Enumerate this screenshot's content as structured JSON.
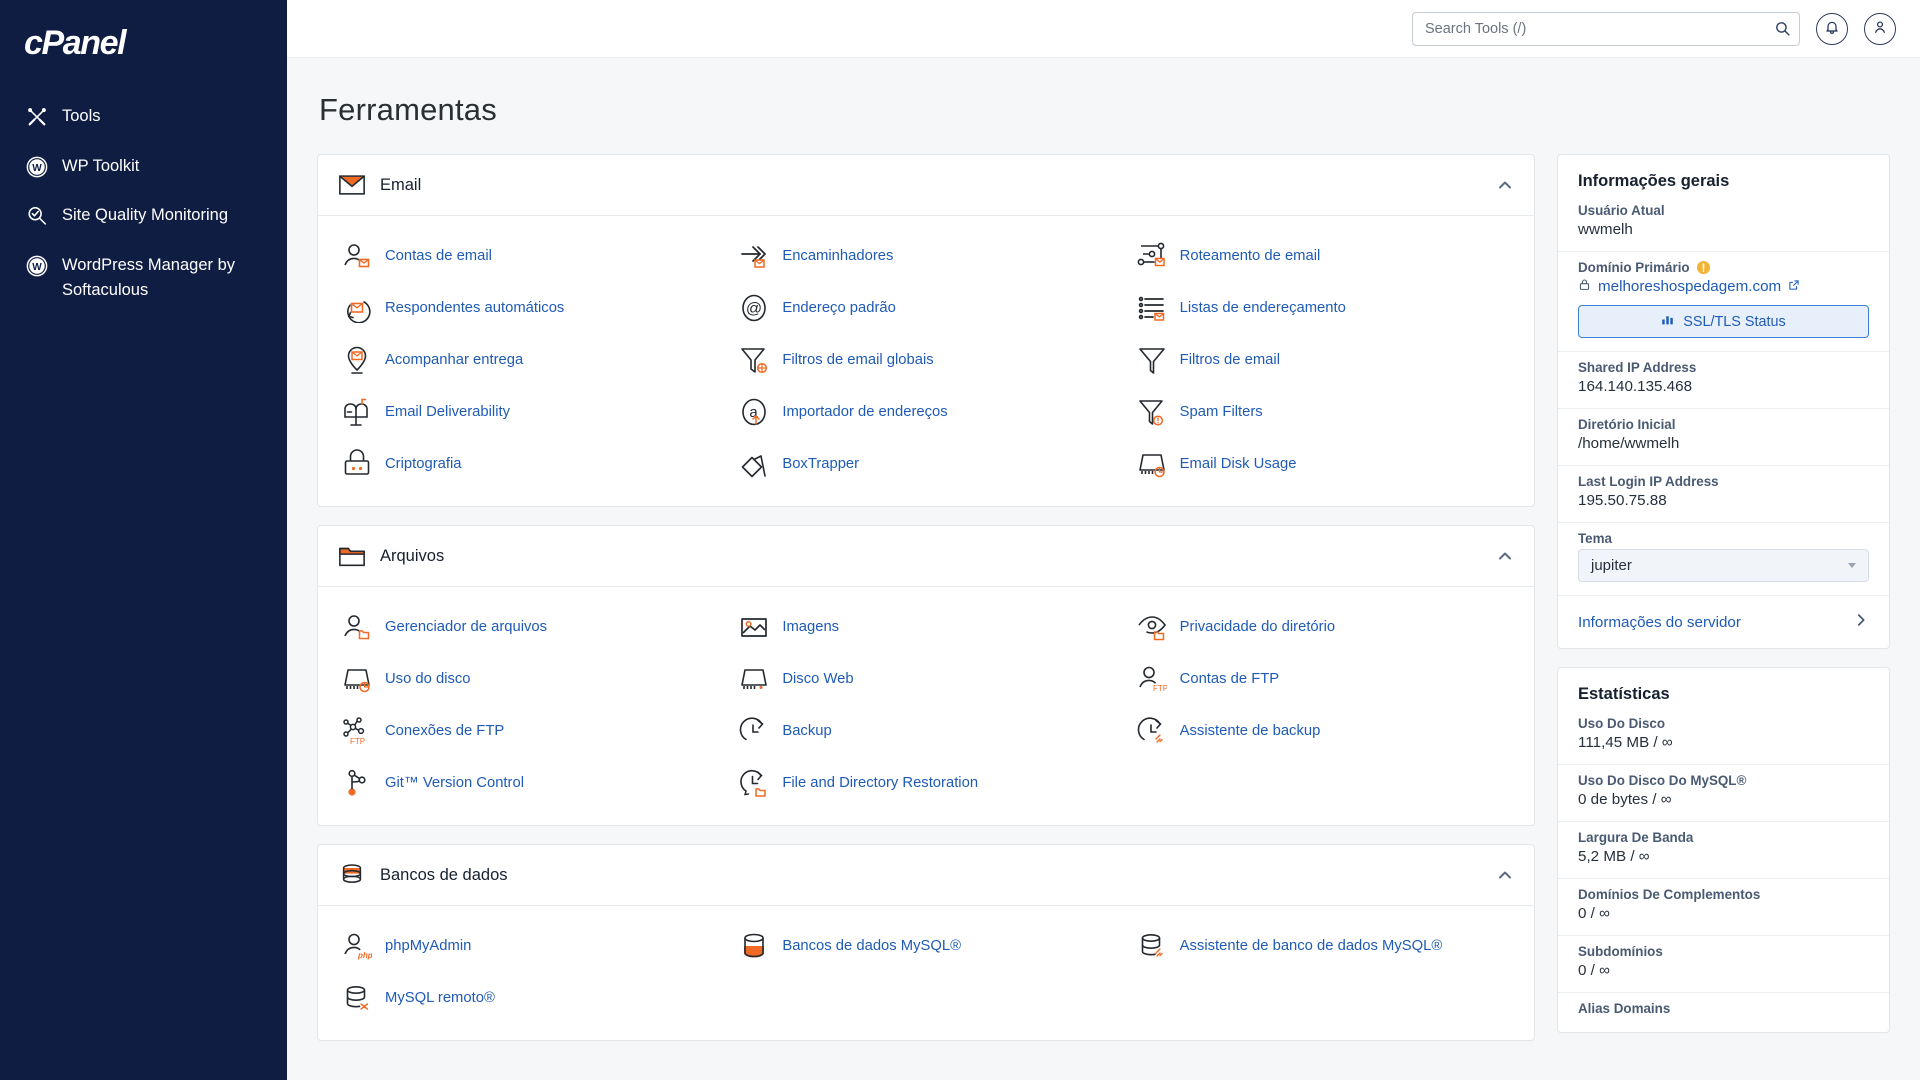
{
  "brand": {
    "logo_text": "cPanel"
  },
  "sidebar": {
    "items": [
      {
        "label": "Tools",
        "icon": "tools-icon"
      },
      {
        "label": "WP Toolkit",
        "icon": "wordpress-icon"
      },
      {
        "label": "Site Quality Monitoring",
        "icon": "search-check-icon"
      },
      {
        "label": "WordPress Manager by Softaculous",
        "icon": "wordpress-icon"
      }
    ]
  },
  "topbar": {
    "search_placeholder": "Search Tools (/)",
    "search_value": "",
    "search_icon": "search-icon",
    "notifications_icon": "bell-icon",
    "account_icon": "user-icon"
  },
  "page": {
    "title": "Ferramentas"
  },
  "sections": [
    {
      "id": "email",
      "title": "Email",
      "icon": "envelope-icon",
      "collapse_icon": "chevron-up-icon",
      "tiles": [
        {
          "label": "Contas de email",
          "icon": "email-accounts-icon"
        },
        {
          "label": "Encaminhadores",
          "icon": "forwarders-icon"
        },
        {
          "label": "Roteamento de email",
          "icon": "email-routing-icon"
        },
        {
          "label": "Respondentes automáticos",
          "icon": "autoresponders-icon"
        },
        {
          "label": "Endereço padrão",
          "icon": "default-address-icon"
        },
        {
          "label": "Listas de endereçamento",
          "icon": "mailing-lists-icon"
        },
        {
          "label": "Acompanhar entrega",
          "icon": "track-delivery-icon"
        },
        {
          "label": "Filtros de email globais",
          "icon": "global-email-filters-icon"
        },
        {
          "label": "Filtros de email",
          "icon": "email-filters-icon"
        },
        {
          "label": "Email Deliverability",
          "icon": "email-deliverability-icon"
        },
        {
          "label": "Importador de endereços",
          "icon": "address-importer-icon"
        },
        {
          "label": "Spam Filters",
          "icon": "spam-filters-icon"
        },
        {
          "label": "Criptografia",
          "icon": "encryption-icon"
        },
        {
          "label": "BoxTrapper",
          "icon": "boxtrapper-icon"
        },
        {
          "label": "Email Disk Usage",
          "icon": "email-disk-usage-icon"
        }
      ]
    },
    {
      "id": "arquivos",
      "title": "Arquivos",
      "icon": "folder-icon",
      "collapse_icon": "chevron-up-icon",
      "tiles": [
        {
          "label": "Gerenciador de arquivos",
          "icon": "file-manager-icon"
        },
        {
          "label": "Imagens",
          "icon": "images-icon"
        },
        {
          "label": "Privacidade do diretório",
          "icon": "directory-privacy-icon"
        },
        {
          "label": "Uso do disco",
          "icon": "disk-usage-icon"
        },
        {
          "label": "Disco Web",
          "icon": "web-disk-icon"
        },
        {
          "label": "Contas de FTP",
          "icon": "ftp-accounts-icon"
        },
        {
          "label": "Conexões de FTP",
          "icon": "ftp-connections-icon"
        },
        {
          "label": "Backup",
          "icon": "backup-icon"
        },
        {
          "label": "Assistente de backup",
          "icon": "backup-wizard-icon"
        },
        {
          "label": "Git™ Version Control",
          "icon": "git-icon"
        },
        {
          "label": "File and Directory Restoration",
          "icon": "file-restore-icon"
        }
      ]
    },
    {
      "id": "bancos",
      "title": "Bancos de dados",
      "icon": "database-icon",
      "collapse_icon": "chevron-up-icon",
      "tiles": [
        {
          "label": "phpMyAdmin",
          "icon": "phpmyadmin-icon"
        },
        {
          "label": "Bancos de dados MySQL®",
          "icon": "mysql-databases-icon"
        },
        {
          "label": "Assistente de banco de dados MySQL®",
          "icon": "mysql-wizard-icon"
        },
        {
          "label": "MySQL remoto®",
          "icon": "remote-mysql-icon"
        }
      ]
    }
  ],
  "general_info": {
    "title": "Informações gerais",
    "current_user_label": "Usuário Atual",
    "current_user_value": "wwmelh",
    "primary_domain_label": "Domínio Primário",
    "primary_domain_warning_icon": "warning-icon",
    "primary_domain_value": "melhoreshospedagem.com",
    "primary_domain_lock_icon": "lock-icon",
    "primary_domain_external_icon": "external-link-icon",
    "ssl_button_label": "SSL/TLS Status",
    "ssl_button_icon": "chart-bars-icon",
    "shared_ip_label": "Shared IP Address",
    "shared_ip_value": "164.140.135.468",
    "home_dir_label": "Diretório Inicial",
    "home_dir_value": "/home/wwmelh",
    "last_login_label": "Last Login IP Address",
    "last_login_value": "195.50.75.88",
    "theme_label": "Tema",
    "theme_value": "jupiter",
    "server_info_label": "Informações do servidor",
    "server_info_icon": "chevron-right-icon"
  },
  "statistics": {
    "title": "Estatísticas",
    "rows": [
      {
        "label": "Uso Do Disco",
        "value": "111,45 MB / ∞"
      },
      {
        "label": "Uso Do Disco Do MySQL®",
        "value": "0 de bytes / ∞"
      },
      {
        "label": "Largura De Banda",
        "value": "5,2 MB / ∞"
      },
      {
        "label": "Domínios De Complementos",
        "value": "0 / ∞"
      },
      {
        "label": "Subdomínios",
        "value": "0 / ∞"
      },
      {
        "label": "Alias Domains",
        "value": ""
      }
    ]
  },
  "colors": {
    "sidebar_bg": "#0f1d42",
    "accent_orange": "#f06a25",
    "link_blue": "#1f5bb6",
    "page_bg": "#f6f7f8"
  }
}
